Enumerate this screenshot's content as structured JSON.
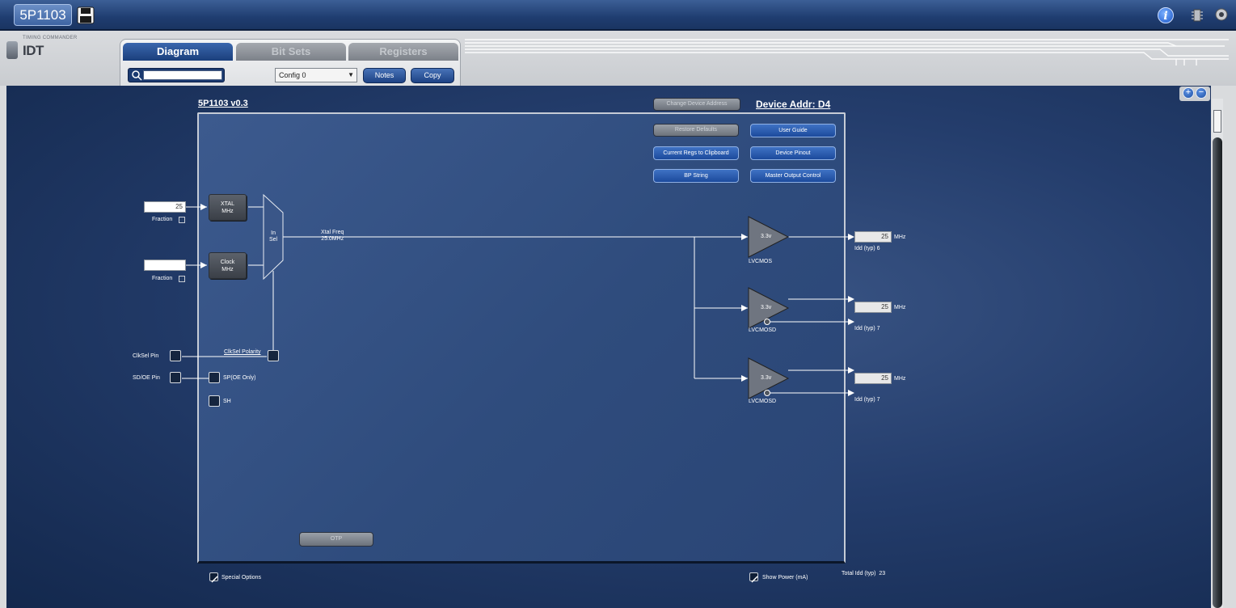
{
  "topbar": {
    "device_title": "5P1103"
  },
  "logo": {
    "small": "TIMING COMMANDER",
    "big": "IDT"
  },
  "tabs": [
    {
      "label": "Diagram",
      "active": true
    },
    {
      "label": "Bit Sets",
      "active": false
    },
    {
      "label": "Registers",
      "active": false
    }
  ],
  "toolbar": {
    "search_value": "",
    "config_value": "Config 0",
    "notes_label": "Notes",
    "copy_label": "Copy"
  },
  "diagram": {
    "title": "5P1103 v0.3",
    "change_address_label": "Change Device Address",
    "device_addr": "Device Addr: D4",
    "buttons": {
      "restore_defaults": "Restore Defaults",
      "user_guide": "User Guide",
      "regs_clipboard": "Current Regs to Clipboard",
      "device_pinout": "Device Pinout",
      "bp_string": "BP String",
      "master_output": "Master Output Control",
      "otp": "OTP"
    },
    "inputs": {
      "xtal_value": "25",
      "clock_value": "",
      "fraction_label": "Fraction",
      "xtal_block": "XTAL\nMHz",
      "xtal_line1": "XTAL",
      "xtal_line2": "MHz",
      "clock_line1": "Clock",
      "clock_line2": "MHz",
      "insel_line1": "In",
      "insel_line2": "Sel",
      "xtal_freq_line1": "Xtal Freq",
      "xtal_freq_line2": "25.0MHz"
    },
    "pins": {
      "clksel_pin": "ClkSel Pin",
      "clksel_polarity": "ClkSel Polarity",
      "sdoe_pin": "SD/OE Pin",
      "sp_oe_only": "SP(OE Only)",
      "sh": "SH"
    },
    "outputs": [
      {
        "voltage": "3.3v",
        "type": "LVCMOS",
        "value": "25",
        "unit": "MHz",
        "idd_label": "Idd (typ)",
        "idd": "6"
      },
      {
        "voltage": "3.3v",
        "type": "LVCMOSD",
        "value": "25",
        "unit": "MHz",
        "idd_label": "Idd (typ)",
        "idd": "7"
      },
      {
        "voltage": "3.3v",
        "type": "LVCMOSD",
        "value": "25",
        "unit": "MHz",
        "idd_label": "Idd (typ)",
        "idd": "7"
      }
    ],
    "special_options": "Special Options",
    "show_power": "Show Power (mA)",
    "total_idd_label": "Total Idd (typ)",
    "total_idd": "23"
  },
  "colors": {
    "accent": "#1d4284",
    "background": "#243d6c"
  },
  "icons": [
    "save-icon",
    "info-icon",
    "chip-icon",
    "gear-icon",
    "search-icon",
    "zoom-in-icon",
    "zoom-out-icon"
  ]
}
